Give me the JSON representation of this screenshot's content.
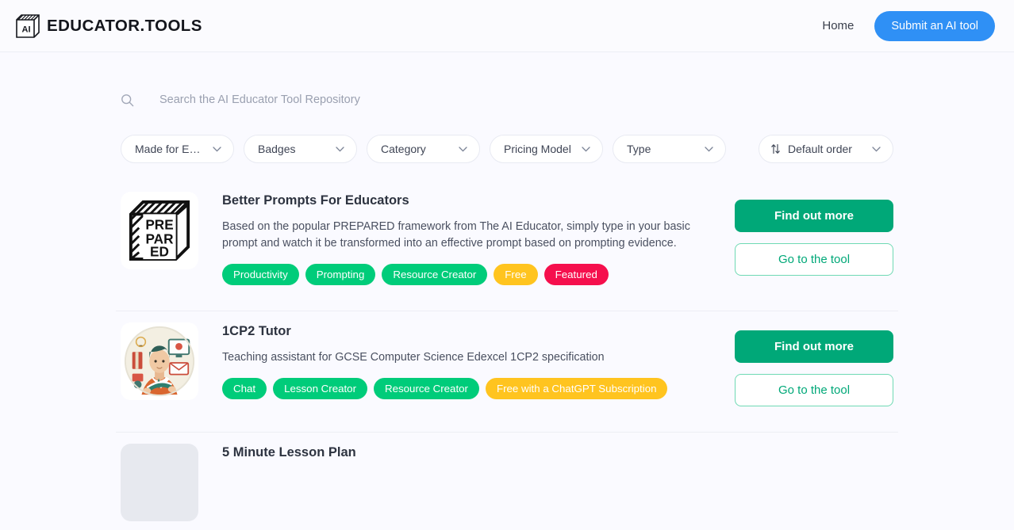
{
  "header": {
    "brand_name": "EDUCATOR.TOOLS",
    "brand_mark": "AI",
    "brand_icon": "ai-cube-logo",
    "nav": {
      "home_label": "Home",
      "submit_label": "Submit an AI tool"
    }
  },
  "search": {
    "icon": "search-icon",
    "placeholder": "Search the AI Educator Tool Repository",
    "value": ""
  },
  "filters": [
    {
      "label": "Made for Edu...",
      "name": "made-for-education"
    },
    {
      "label": "Badges",
      "name": "badges"
    },
    {
      "label": "Category",
      "name": "category"
    },
    {
      "label": "Pricing Model",
      "name": "pricing-model"
    },
    {
      "label": "Type",
      "name": "type"
    }
  ],
  "sort": {
    "icon": "sort-arrows-icon",
    "label": "Default order"
  },
  "actions": {
    "find_out_more": "Find out more",
    "go_to_tool": "Go to the tool"
  },
  "tools": [
    {
      "title": "Better Prompts For Educators",
      "description": "Based on the popular PREPARED framework from The AI Educator, simply type in your basic prompt and watch it be transformed into an effective prompt based on prompting evidence.",
      "thumb_icon": "prepared-cube-logo",
      "thumb_text": [
        "PRE",
        "PAR",
        "ED"
      ],
      "tags": [
        {
          "label": "Productivity",
          "style": "green"
        },
        {
          "label": "Prompting",
          "style": "green"
        },
        {
          "label": "Resource Creator",
          "style": "green"
        },
        {
          "label": "Free",
          "style": "yellow"
        },
        {
          "label": "Featured",
          "style": "featured"
        }
      ]
    },
    {
      "title": "1CP2 Tutor",
      "description": "Teaching assistant for GCSE Computer Science Edexcel 1CP2 specification",
      "thumb_icon": "teacher-illustration-avatar",
      "tags": [
        {
          "label": "Chat",
          "style": "green"
        },
        {
          "label": "Lesson Creator",
          "style": "green"
        },
        {
          "label": "Resource Creator",
          "style": "green"
        },
        {
          "label": "Free with a ChatGPT Subscription",
          "style": "yellow"
        }
      ]
    },
    {
      "title": "5 Minute Lesson Plan",
      "description": "",
      "thumb_icon": "placeholder-thumbnail",
      "tags": []
    }
  ],
  "colors": {
    "accent_blue": "#2f90f5",
    "tag_green": "#00cc7a",
    "button_green": "#00a878",
    "tag_yellow": "#ffc41f",
    "tag_featured": "#f50f4d",
    "page_bg": "#fafaff"
  }
}
